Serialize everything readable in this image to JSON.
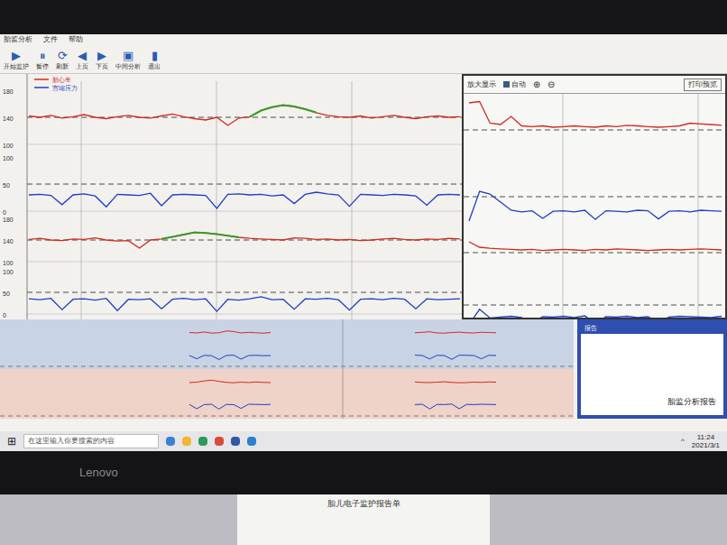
{
  "window": {
    "title": "胎监分析",
    "menu": [
      "文件",
      "帮助"
    ]
  },
  "toolbar": [
    {
      "icon": "▶",
      "label": "开始监护"
    },
    {
      "icon": "⏸",
      "label": "暂停"
    },
    {
      "icon": "⟳",
      "label": "刷新"
    },
    {
      "icon": "◀",
      "label": "上页"
    },
    {
      "icon": "▶",
      "label": "下页"
    },
    {
      "icon": "▣",
      "label": "中间分析"
    },
    {
      "icon": "▮",
      "label": "退出"
    }
  ],
  "legend": [
    {
      "label": "胎心率",
      "color": "#d42a1e"
    },
    {
      "label": "宫缩压力",
      "color": "#1f3fc4"
    }
  ],
  "axis": {
    "fhr_ticks": [
      "180",
      "140",
      "100"
    ],
    "toco_ticks": [
      "100",
      "50",
      "0"
    ]
  },
  "main_chart": {
    "series": [
      {
        "kind": "fhr",
        "color": "#d42a1e",
        "values": [
          142,
          140,
          143,
          139,
          141,
          144,
          140,
          138,
          141,
          143,
          140,
          139,
          142,
          145,
          141,
          138,
          136,
          140,
          128,
          139,
          141,
          150,
          155,
          158,
          156,
          152,
          147,
          143,
          141,
          140,
          142,
          139,
          141,
          143,
          140,
          138,
          141,
          142,
          140,
          141
        ],
        "highlight": {
          "start": 20,
          "end": 26,
          "color": "#3a9a2a"
        }
      },
      {
        "kind": "toco",
        "color": "#1f3fc4",
        "values": [
          30,
          31,
          29,
          12,
          30,
          32,
          28,
          8,
          31,
          30,
          29,
          33,
          10,
          30,
          31,
          30,
          29,
          5,
          31,
          32,
          30,
          31,
          28,
          30,
          14,
          31,
          35,
          32,
          30,
          9,
          31,
          30,
          29,
          31,
          30,
          28,
          11,
          30,
          31,
          30
        ]
      },
      {
        "kind": "fhr",
        "color": "#d42a1e",
        "values": [
          141,
          143,
          140,
          139,
          142,
          141,
          144,
          140,
          138,
          139,
          125,
          140,
          142,
          146,
          150,
          154,
          153,
          151,
          148,
          145,
          143,
          142,
          141,
          140,
          144,
          143,
          141,
          142,
          140,
          141,
          139,
          140,
          142,
          143,
          141,
          140,
          142,
          141,
          143,
          142
        ],
        "highlight": {
          "start": 12,
          "end": 19,
          "color": "#3a9a2a"
        }
      },
      {
        "kind": "toco",
        "color": "#1f3fc4",
        "values": [
          35,
          33,
          36,
          10,
          34,
          35,
          32,
          36,
          8,
          34,
          33,
          35,
          12,
          34,
          36,
          33,
          35,
          6,
          34,
          32,
          35,
          40,
          33,
          34,
          11,
          35,
          34,
          36,
          33,
          9,
          34,
          35,
          33,
          36,
          34,
          12,
          35,
          33,
          34,
          35
        ]
      }
    ]
  },
  "zoom_window": {
    "title": "放大显示",
    "options": [
      {
        "label": "自动",
        "checked": true
      }
    ],
    "buttons": [
      "⊕",
      "⊖"
    ],
    "side_label": "打印预览",
    "series": [
      {
        "kind": "fhr",
        "color": "#d42a1e",
        "values": [
          180,
          182,
          150,
          148,
          160,
          146,
          145,
          146,
          144,
          145,
          146,
          145,
          144,
          146,
          145,
          147,
          146,
          145,
          144,
          145,
          146,
          150,
          149,
          148,
          147
        ]
      },
      {
        "kind": "toco",
        "color": "#1f3fc4",
        "values": [
          5,
          60,
          55,
          40,
          25,
          22,
          24,
          10,
          23,
          24,
          22,
          25,
          8,
          24,
          23,
          22,
          25,
          24,
          9,
          23,
          24,
          22,
          25,
          24,
          23
        ]
      },
      {
        "kind": "fhr",
        "color": "#d42a1e",
        "values": [
          160,
          150,
          148,
          147,
          146,
          145,
          146,
          144,
          145,
          146,
          145,
          144,
          146,
          145,
          147,
          146,
          145,
          144,
          145,
          146,
          145,
          146,
          147,
          146,
          145
        ]
      },
      {
        "kind": "toco",
        "color": "#1f3fc4",
        "values": [
          5,
          40,
          20,
          22,
          24,
          21,
          10,
          23,
          22,
          24,
          21,
          25,
          8,
          23,
          22,
          24,
          21,
          23,
          10,
          22,
          24,
          23,
          22,
          21,
          24
        ]
      }
    ]
  },
  "overview": [
    {
      "fhr": [
        142,
        140,
        145,
        139,
        141,
        150,
        147,
        140,
        143,
        141,
        139,
        142
      ],
      "toco": [
        30,
        12,
        31,
        29,
        8,
        30,
        32,
        10,
        30,
        31,
        29,
        30
      ]
    },
    {
      "fhr": [
        141,
        143,
        146,
        140,
        139,
        142,
        144,
        141,
        140,
        143,
        142,
        141
      ],
      "toco": [
        32,
        30,
        11,
        31,
        30,
        9,
        32,
        31,
        30,
        12,
        31,
        30
      ]
    },
    {
      "fhr": [
        140,
        142,
        148,
        152,
        146,
        141,
        139,
        142,
        140,
        143,
        141,
        140
      ],
      "toco": [
        34,
        10,
        33,
        35,
        8,
        34,
        33,
        12,
        35,
        34,
        33,
        34
      ]
    },
    {
      "fhr": [
        143,
        141,
        140,
        142,
        144,
        141,
        139,
        140,
        142,
        141,
        143,
        142
      ],
      "toco": [
        33,
        35,
        9,
        34,
        33,
        36,
        10,
        34,
        33,
        35,
        34,
        33
      ]
    }
  ],
  "report_box": {
    "title": "报告",
    "text": "胎监分析报告"
  },
  "taskbar": {
    "start": "⊞",
    "search_placeholder": "在这里输入你要搜索的内容",
    "apps": [
      {
        "color": "#3b7fd6"
      },
      {
        "color": "#f2b632"
      },
      {
        "color": "#2b9a5b"
      },
      {
        "color": "#d84a3a"
      },
      {
        "color": "#3355aa"
      },
      {
        "color": "#2f7fd0"
      }
    ],
    "tray": "^",
    "time": "11:24",
    "date": "2021/3/1"
  },
  "monitor": {
    "brand": "Lenovo"
  },
  "paper": {
    "title": "胎儿电子监护报告单"
  }
}
